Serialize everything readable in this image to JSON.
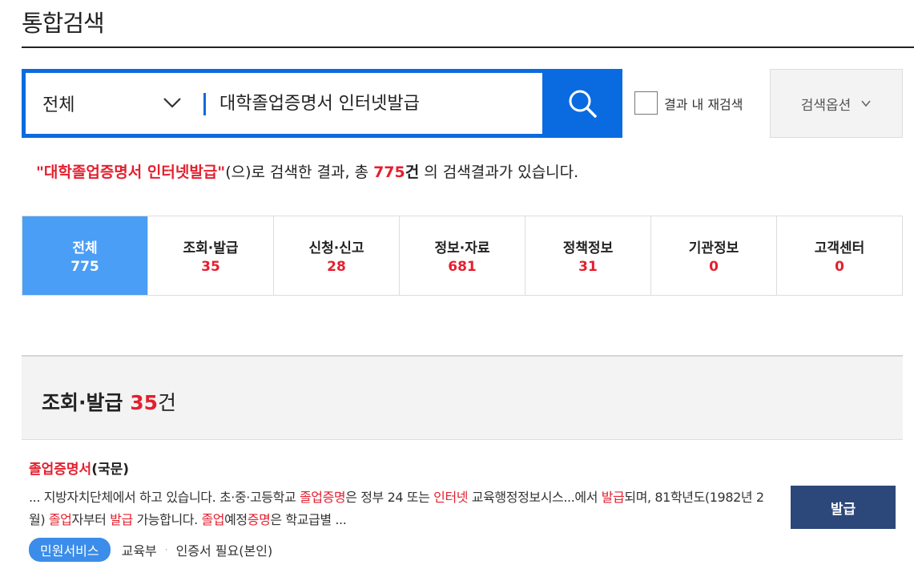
{
  "page": {
    "title": "통합검색"
  },
  "search": {
    "scope_value": "전체",
    "query": "대학졸업증명서 인터넷발급",
    "recheck_label": "결과 내 재검색",
    "options_label": "검색옵션"
  },
  "summary": {
    "query_quoted": "\"대학졸업증명서 인터넷발급\"",
    "part1": "(으)로 검색한 결과, 총 ",
    "count": "775",
    "unit": "건",
    "part2": " 의 검색결과가 있습니다."
  },
  "tabs": [
    {
      "label": "전체",
      "count": "775",
      "active": true
    },
    {
      "label": "조회·발급",
      "count": "35"
    },
    {
      "label": "신청·신고",
      "count": "28"
    },
    {
      "label": "정보·자료",
      "count": "681"
    },
    {
      "label": "정책정보",
      "count": "31"
    },
    {
      "label": "기관정보",
      "count": "0"
    },
    {
      "label": "고객센터",
      "count": "0"
    }
  ],
  "section": {
    "title": "조회·발급",
    "count": "35",
    "unit": "건"
  },
  "result": {
    "title_hl": "졸업증명서",
    "title_rest": "(국문)",
    "desc": [
      {
        "t": "... 지방자치단체에서 하고 있습니다. 초·중·고등학교 "
      },
      {
        "t": "졸업증명",
        "hl": true
      },
      {
        "t": "은 정부 24 또는 "
      },
      {
        "t": "인터넷",
        "hl": true
      },
      {
        "t": " 교육행정정보시스...에서 "
      },
      {
        "t": "발급",
        "hl": true
      },
      {
        "t": "되며, 81학년도(1982년 2월) "
      },
      {
        "t": "졸업",
        "hl": true
      },
      {
        "t": "자부터 "
      },
      {
        "t": "발급",
        "hl": true
      },
      {
        "t": " 가능합니다. "
      },
      {
        "t": "졸업",
        "hl": true
      },
      {
        "t": "예정"
      },
      {
        "t": "증명",
        "hl": true
      },
      {
        "t": "은 학교급별 ..."
      }
    ],
    "button_label": "발급",
    "badge": "민원서비스",
    "agency": "교육부",
    "requirement": "인증서 필요(본인)"
  },
  "colors": {
    "primary": "#0a6be0",
    "highlight": "#e3202f",
    "active_tab": "#4a9ef5",
    "button_navy": "#2c4779"
  }
}
